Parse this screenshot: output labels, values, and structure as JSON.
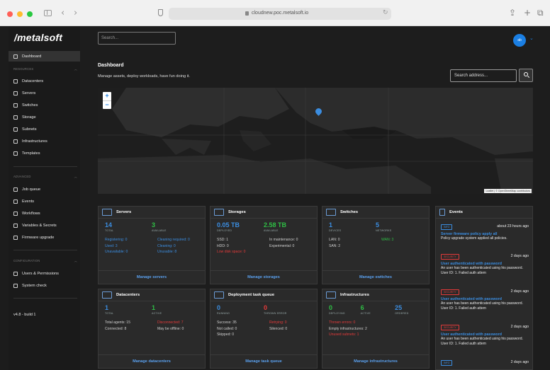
{
  "browser": {
    "url": "cloudnew.poc.metalsoft.io"
  },
  "sidebar": {
    "logo": "/metalsoft",
    "dashboard": "Dashboard",
    "resources_title": "RESOURCES",
    "resources": [
      "Datacenters",
      "Servers",
      "Switches",
      "Storage",
      "Subnets",
      "Infrastructures",
      "Templates"
    ],
    "advanced_title": "ADVANCED",
    "advanced": [
      "Job queue",
      "Events",
      "Workflows",
      "Variables & Secrets",
      "Firmware upgrade"
    ],
    "configuration_title": "CONFIGURATION",
    "configuration": [
      "Users & Permissions",
      "System check"
    ],
    "version": "v4.8 - build 1"
  },
  "header": {
    "search_placeholder": "Search...",
    "avatar_initials": "ab"
  },
  "page": {
    "title": "Dashboard",
    "subtitle": "Manage assets, deploy workloads, have fun doing it.",
    "address_placeholder": "Search address..."
  },
  "map": {
    "zoom_in": "+",
    "zoom_out": "−",
    "attribution": "Leaflet | © OpenStreetMap contributors"
  },
  "cards": {
    "servers": {
      "title": "Servers",
      "k1": "14",
      "k1l": "TOTAL",
      "k2": "3",
      "k2l": "AVAILABLE",
      "r": [
        "Registering: 0",
        "Cleaning required: 0",
        "Used: 3",
        "Cleaning: 0",
        "Unavailable: 0",
        "Unusable: 8"
      ],
      "footer": "Manage servers"
    },
    "storages": {
      "title": "Storages",
      "k1": "0.05 TB",
      "k1l": "DEPLOYED",
      "k2": "2.58 TB",
      "k2l": "AVAILABLE",
      "r": [
        "SSD: 1",
        "In maintenance: 0",
        "HDD: 0",
        "Experimental: 0",
        "Low disk space: 0"
      ],
      "footer": "Manage storages"
    },
    "switches": {
      "title": "Switches",
      "k1": "1",
      "k1l": "DEVICES",
      "k2": "5",
      "k2l": "NETWORKS",
      "r": [
        "LAN: 0",
        "WAN: 3",
        "SAN: 2"
      ],
      "footer": "Manage switches"
    },
    "datacenters": {
      "title": "Datacenters",
      "k1": "1",
      "k1l": "TOTAL",
      "k2": "1",
      "k2l": "ACTIVE",
      "r": [
        "Total agents: 15",
        "Disconnected: 7",
        "Connected: 8",
        "May be offline: 0"
      ],
      "footer": "Manage datacenters"
    },
    "deployment": {
      "title": "Deployment task queue",
      "k1": "0",
      "k1l": "RUNNING",
      "k2": "0",
      "k2l": "THROWN ERROR",
      "r": [
        "Success: 35",
        "Retrying: 0",
        "Not called: 0",
        "Silenced: 0",
        "Skipped: 0"
      ],
      "footer": "Manage task queue"
    },
    "infrastructures": {
      "title": "Infrastructures",
      "k1": "0",
      "k1l": "DEPLOYING",
      "k2": "6",
      "k2l": "ACTIVE",
      "k3": "25",
      "k3l": "ORDERED",
      "r": [
        "Thrown errors: 0",
        "Empty infrastructures: 2",
        "Unused subnets: 1"
      ],
      "footer": "Manage infrastructures"
    }
  },
  "events": {
    "title": "Events",
    "items": [
      {
        "badge": "INFO",
        "time": "about 23 hours ago",
        "title": "Server firmware policy apply all",
        "desc": "Policy upgrade system applied all policies."
      },
      {
        "badge": "SECURITY",
        "time": "2 days ago",
        "title": "User authenticated with password",
        "desc": "An user has been authenticated using his password. User ID: 1. Failed auth attem"
      },
      {
        "badge": "SECURITY",
        "time": "2 days ago",
        "title": "User authenticated with password",
        "desc": "An user has been authenticated using his password. User ID: 1. Failed auth attem"
      },
      {
        "badge": "SECURITY",
        "time": "2 days ago",
        "title": "User authenticated with password",
        "desc": "An user has been authenticated using his password. User ID: 1. Failed auth attem"
      },
      {
        "badge": "INFO",
        "time": "2 days ago"
      }
    ]
  }
}
